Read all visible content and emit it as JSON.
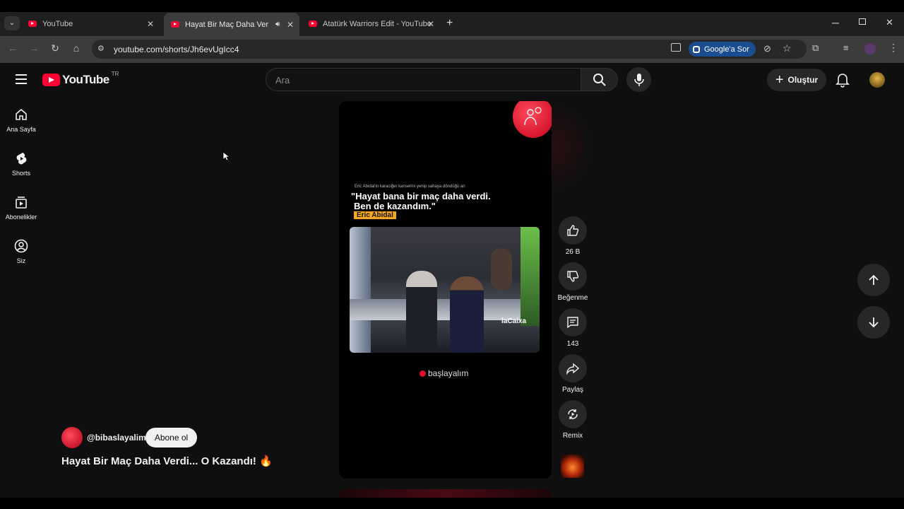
{
  "browser": {
    "tabs": [
      {
        "title": "YouTube"
      },
      {
        "title": "Hayat Bir Maç Daha Verdi..."
      },
      {
        "title": "Atatürk Warriors Edit - YouTube"
      }
    ],
    "url": "youtube.com/shorts/Jh6evUgIcc4",
    "google_ask": "Google'a Sor"
  },
  "youtube": {
    "logo_text": "YouTube",
    "region": "TR",
    "search_placeholder": "Ara",
    "create_label": "Oluştur",
    "nav": [
      {
        "label": "Ana Sayfa",
        "icon": "home-icon"
      },
      {
        "label": "Shorts",
        "icon": "shorts-icon"
      },
      {
        "label": "Abonelikler",
        "icon": "subscriptions-icon"
      },
      {
        "label": "Siz",
        "icon": "profile-icon"
      }
    ]
  },
  "short": {
    "caption_small": "Eric Abidal'in karaciğer kanserini yenip sahaya döndüğü an",
    "quote_line1": "\"Hayat bana bir maç daha verdi.",
    "quote_line2": "Ben de kazandım.\"",
    "name_tag": "Eric Abidal",
    "watermark": "başlayalım",
    "banner": "laCaixa",
    "channel": "@bibaslayalim",
    "subscribe": "Abone ol",
    "title": "Hayat Bir Maç Daha Verdi... O Kazandı! 🔥",
    "likes": "26 B",
    "dislike_label": "Beğenme",
    "comments": "143",
    "share_label": "Paylaş",
    "remix_label": "Remix"
  },
  "colors": {
    "brand": "#ff0033",
    "quote_tag": "#f5a623",
    "bg": "#0f0f0f"
  }
}
